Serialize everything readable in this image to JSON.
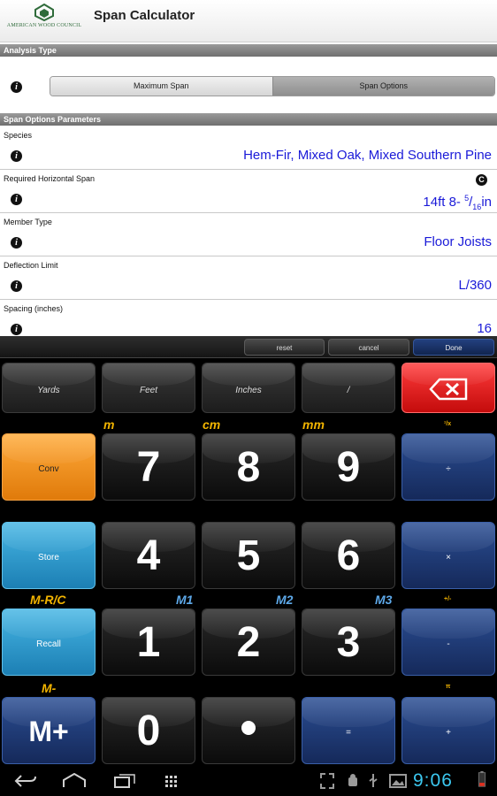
{
  "app": {
    "logo_text": "AMERICAN WOOD COUNCIL",
    "title": "Span Calculator",
    "brand_color": "#2f6b3a"
  },
  "analysis": {
    "header": "Analysis Type",
    "segments": [
      {
        "label": "Maximum Span",
        "selected": false
      },
      {
        "label": "Span Options",
        "selected": true
      }
    ]
  },
  "params": {
    "header": "Span Options Parameters",
    "species": {
      "label": "Species",
      "value": "Hem-Fir, Mixed Oak, Mixed Southern Pine"
    },
    "span": {
      "label": "Required Horizontal Span",
      "value_main": "14ft 8- ",
      "value_num": "5",
      "value_sep": "/",
      "value_den": "16",
      "value_unit": "in"
    },
    "member": {
      "label": "Member Type",
      "value": "Floor Joists"
    },
    "deflection": {
      "label": "Deflection Limit",
      "value": "L/360"
    },
    "spacing": {
      "label": "Spacing (inches)",
      "value": "16"
    }
  },
  "keypad": {
    "reset": "reset",
    "cancel": "cancel",
    "done": "Done",
    "units": [
      "Yards",
      "Feet",
      "Inches",
      "/"
    ],
    "captions": {
      "m": "m",
      "cm": "cm",
      "mm": "mm",
      "inv": "¹/x",
      "mrc": "M-R/C",
      "m1": "M1",
      "m2": "M2",
      "m3": "M3",
      "pm": "+/-",
      "mminus": "M-",
      "pi": "π"
    },
    "conv": "Conv",
    "store": "Store",
    "recall": "Recall",
    "mplus": "M+",
    "digits": {
      "d7": "7",
      "d8": "8",
      "d9": "9",
      "d4": "4",
      "d5": "5",
      "d6": "6",
      "d1": "1",
      "d2": "2",
      "d3": "3",
      "d0": "0"
    },
    "ops": {
      "divide": "÷",
      "times": "×",
      "minus": "-",
      "equals": "=",
      "plus": "+"
    }
  },
  "status": {
    "clock": "9:06",
    "accent": "#3cc8f0"
  }
}
